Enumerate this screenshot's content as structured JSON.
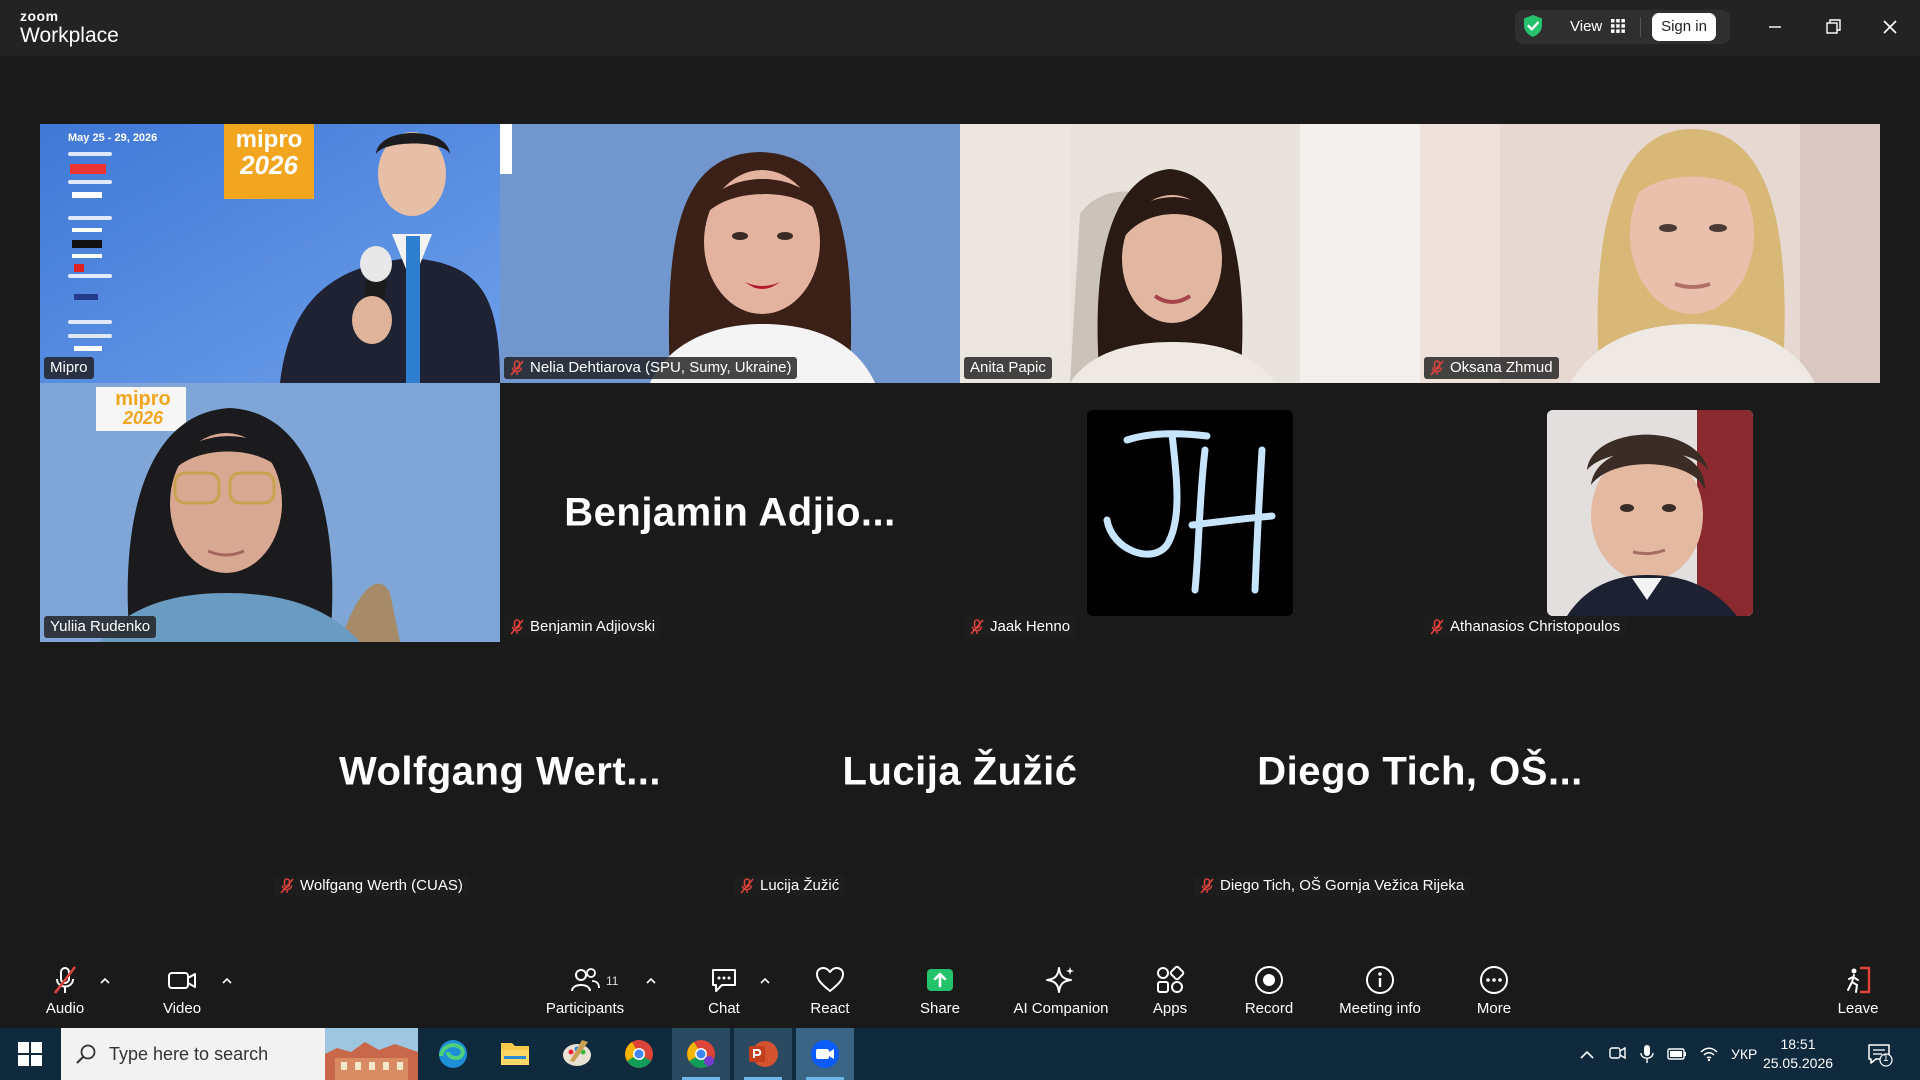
{
  "app": {
    "brand_top": "zoom",
    "brand_name": "Workplace",
    "view_label": "View",
    "sign_in_label": "Sign in"
  },
  "tiles": [
    {
      "name": "Mipro",
      "muted": false,
      "active": true,
      "type": "video"
    },
    {
      "name": "Nelia Dehtiarova (SPU, Sumy, Ukraine)",
      "muted": true,
      "type": "video"
    },
    {
      "name": "Anita Papic",
      "muted": false,
      "type": "video"
    },
    {
      "name": "Oksana Zhmud",
      "muted": true,
      "type": "video"
    },
    {
      "name": "Yuliia Rudenko",
      "muted": false,
      "type": "video"
    },
    {
      "name": "Benjamin Adjiovski",
      "display": "Benjamin  Adjio...",
      "muted": true,
      "type": "name"
    },
    {
      "name": "Jaak Henno",
      "muted": true,
      "type": "avatar",
      "avatar_text": "JH"
    },
    {
      "name": "Athanasios Christopoulos",
      "muted": true,
      "type": "avatar"
    },
    {
      "name": "Wolfgang Werth (CUAS)",
      "display": "Wolfgang  Wert...",
      "muted": true,
      "type": "name"
    },
    {
      "name": "Lucija Žužić",
      "display": "Lucija Žužić",
      "muted": true,
      "type": "name"
    },
    {
      "name": "Diego Tich, OŠ Gornja Vežica Rijeka",
      "display": "Diego  Tich,  OŠ...",
      "muted": true,
      "type": "name"
    }
  ],
  "slide": {
    "date": "May 25 - 29, 2026",
    "logo": "mipro",
    "year": "2026"
  },
  "toolbar": {
    "audio": "Audio",
    "video": "Video",
    "participants": "Participants",
    "participants_count": "11",
    "chat": "Chat",
    "react": "React",
    "share": "Share",
    "ai_companion": "AI Companion",
    "apps": "Apps",
    "record": "Record",
    "meeting_info": "Meeting info",
    "more": "More",
    "leave": "Leave"
  },
  "taskbar": {
    "search_placeholder": "Type here to search",
    "language": "УКР",
    "time": "18:51",
    "date": "25.05.2026",
    "notification_count": "1"
  },
  "colors": {
    "active_speaker": "#23d18b",
    "share_green": "#23c26b",
    "muted_red": "#e0423c",
    "leave_red": "#e0423c"
  }
}
